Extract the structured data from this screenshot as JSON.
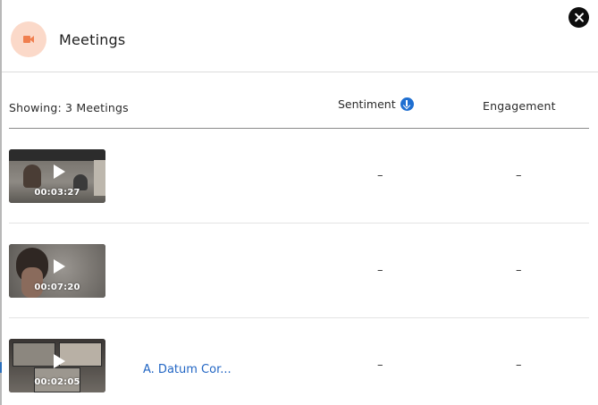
{
  "header": {
    "title": "Meetings",
    "icon": "video-camera-icon",
    "accent_color": "#f07f4f",
    "close_icon": "close-icon"
  },
  "table": {
    "showing_label": "Showing: 3 Meetings",
    "columns": {
      "sentiment": "Sentiment",
      "engagement": "Engagement"
    },
    "sort_icon": "arrow-down-circle-icon",
    "rows": [
      {
        "duration": "00:03:27",
        "company": "",
        "sentiment": "–",
        "engagement": "–"
      },
      {
        "duration": "00:07:20",
        "company": "",
        "sentiment": "–",
        "engagement": "–"
      },
      {
        "duration": "00:02:05",
        "company": "A. Datum Cor...",
        "sentiment": "–",
        "engagement": "–"
      }
    ]
  }
}
